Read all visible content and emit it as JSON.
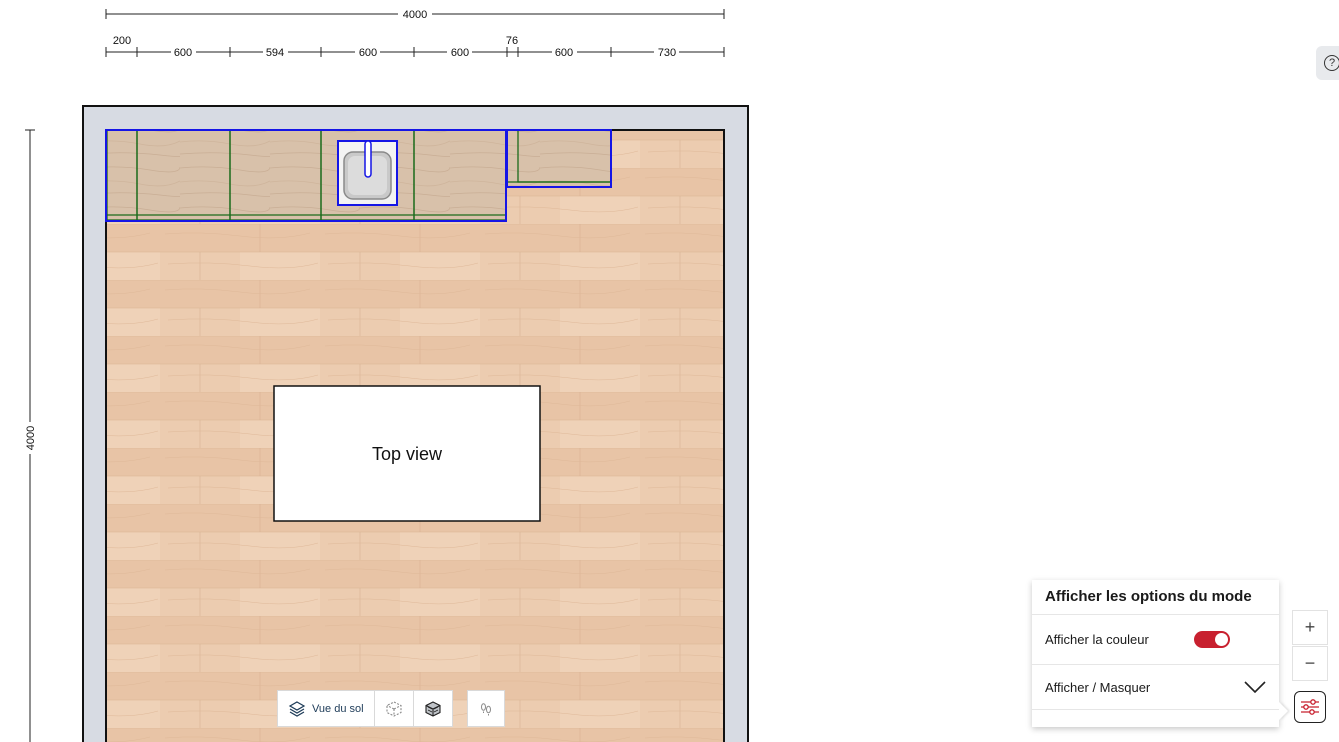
{
  "dimensions": {
    "overall_width": "4000",
    "segments": [
      "200",
      "600",
      "594",
      "600",
      "600",
      "76",
      "600",
      "730"
    ],
    "overall_height": "4000"
  },
  "plan": {
    "center_label": "Top view"
  },
  "view_toolbar": {
    "floor_view_label": "Vue du sol",
    "icons": [
      "floor-layers-icon",
      "wireframe-cube-icon",
      "solid-cube-icon",
      "footprints-icon"
    ]
  },
  "mode_options_panel": {
    "title": "Afficher les options du mode",
    "show_color_label": "Afficher la couleur",
    "show_color_enabled": true,
    "show_hide_label": "Afficher / Masquer"
  },
  "zoom": {
    "zoom_in_symbol": "+",
    "zoom_out_symbol": "−"
  },
  "help": {
    "symbol": "?"
  },
  "colors": {
    "wall": "#d7dbe3",
    "floor": "#e9c9ac",
    "selection_outline": "#1515e6",
    "cabinet_outline": "#1b6b1b",
    "toggle_on": "#c8202f"
  }
}
